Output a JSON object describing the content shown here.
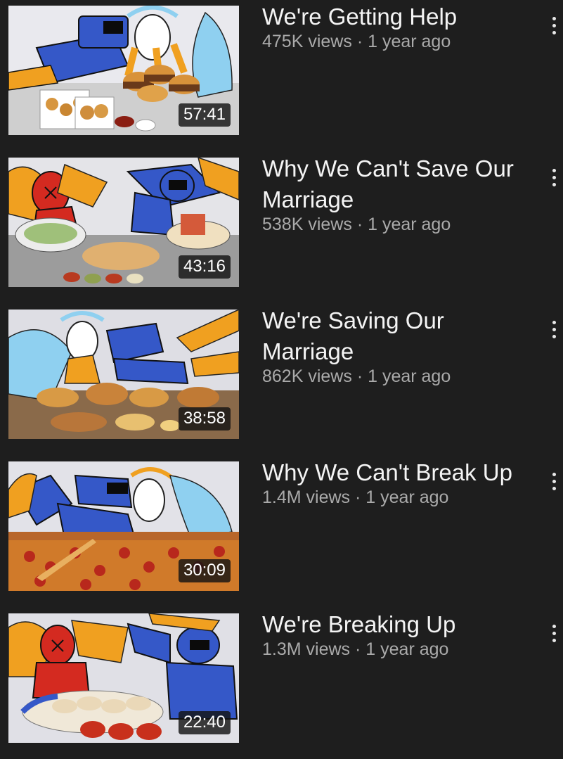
{
  "videos": [
    {
      "title": "We're Getting Help",
      "views": "475K views",
      "age": "1 year ago",
      "duration": "57:41",
      "thumbnail": "drawing-blue-robot-and-angel-over-burgers-and-nuggets"
    },
    {
      "title": "Why We Can't Save Our Marriage",
      "views": "538K views",
      "age": "1 year ago",
      "duration": "43:16",
      "thumbnail": "drawing-red-knight-and-blue-robot-over-tacos-and-salad"
    },
    {
      "title": "We're Saving Our Marriage",
      "views": "862K views",
      "age": "1 year ago",
      "duration": "38:58",
      "thumbnail": "drawing-angel-and-blue-robot-over-fried-chicken-platter"
    },
    {
      "title": "Why We Can't Break Up",
      "views": "1.4M views",
      "age": "1 year ago",
      "duration": "30:09",
      "thumbnail": "drawing-blue-robot-and-angel-over-pepperoni-pizza"
    },
    {
      "title": "We're Breaking Up",
      "views": "1.3M views",
      "age": "1 year ago",
      "duration": "22:40",
      "thumbnail": "drawing-red-knight-and-blue-robot-over-dumplings"
    }
  ],
  "meta_separator": "·",
  "menu_icon": "more-vert-icon",
  "colors": {
    "background": "#1e1e1e",
    "title": "#f4f4f4",
    "meta": "#aaaaaa",
    "robot_blue": "#3558c8",
    "angel_orange": "#f0a020",
    "wing_lightblue": "#8fd0f0",
    "knight_red": "#d42a20"
  }
}
